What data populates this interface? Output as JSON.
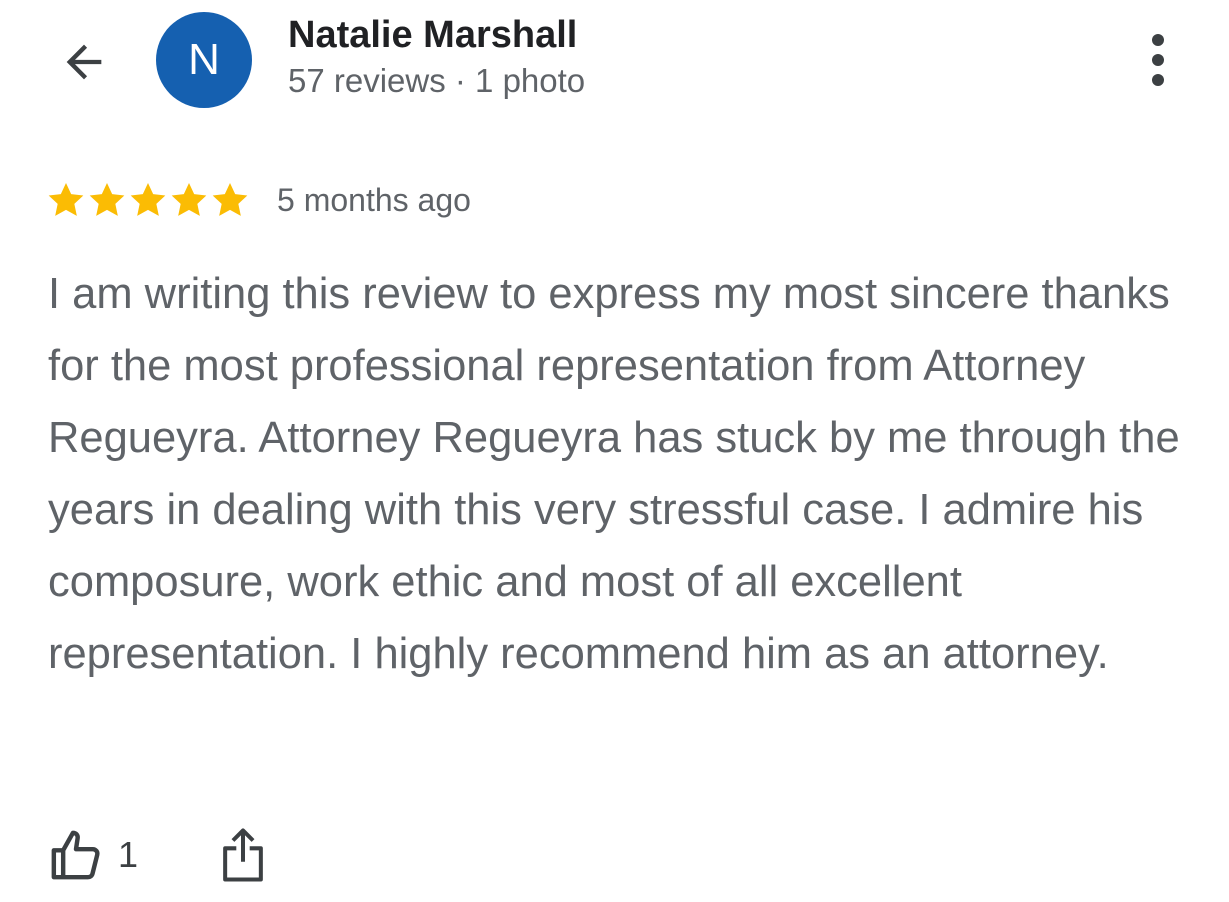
{
  "header": {
    "back_icon": "arrow-left-icon",
    "avatar_letter": "N",
    "avatar_color": "#1560b0",
    "user_name": "Natalie Marshall",
    "user_meta": "57 reviews · 1 photo",
    "more_icon": "more-vert-icon"
  },
  "review": {
    "rating": 5,
    "rating_max": 5,
    "star_color": "#fbbc04",
    "date": "5 months ago",
    "text": "I am writing this review to express my most sincere thanks for the most professional representation from Attorney Regueyra. Attorney Regueyra has stuck by me through the years in dealing with this very stressful case. I admire his composure, work ethic and most of all excellent representation. I highly recommend him as an attorney."
  },
  "actions": {
    "like_icon": "thumbs-up-icon",
    "like_count": "1",
    "share_icon": "share-icon"
  }
}
